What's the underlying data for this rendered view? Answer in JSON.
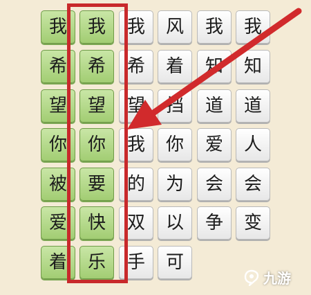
{
  "board": {
    "rows": [
      [
        "我",
        "我",
        "我",
        "风",
        "我",
        "我"
      ],
      [
        "希",
        "希",
        "希",
        "着",
        "知",
        "知"
      ],
      [
        "望",
        "望",
        "望",
        "挡",
        "道",
        "道"
      ],
      [
        "你",
        "你",
        "我",
        "你",
        "爱",
        "人"
      ],
      [
        "被",
        "要",
        "的",
        "为",
        "会",
        "会"
      ],
      [
        "爱",
        "快",
        "双",
        "以",
        "争",
        "变"
      ],
      [
        "着",
        "乐",
        "手",
        "可",
        "",
        ""
      ]
    ],
    "matched_columns": [
      0,
      1
    ],
    "highlighted_column": 1
  },
  "annotation": {
    "arrow_color": "#d12a2c",
    "box_color": "#c8292b"
  },
  "watermark": {
    "logo_icon": "jiuyou-logo-icon",
    "text": "九游"
  },
  "colors": {
    "background": "#f4ebd6",
    "tile_green": "#b6da8c",
    "tile_white": "#f7f7f7",
    "highlight_red": "#c8292b"
  }
}
